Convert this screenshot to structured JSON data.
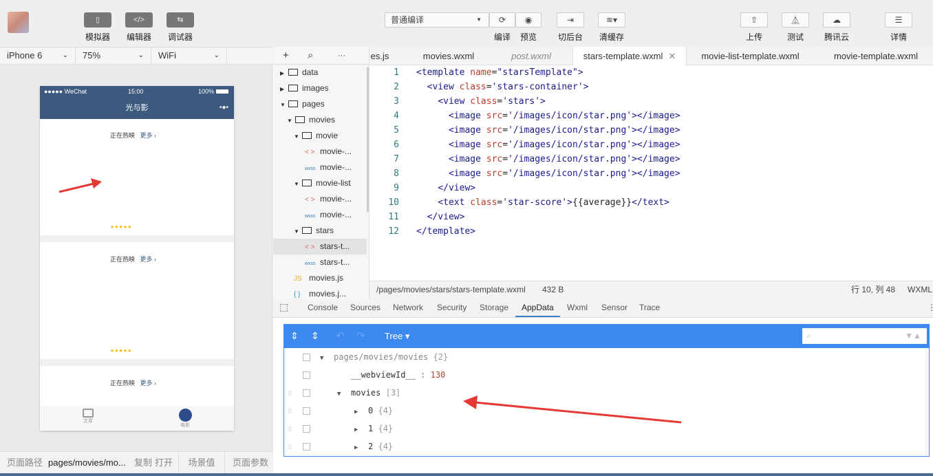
{
  "toolbar": {
    "left": [
      {
        "icon": "phone-icon",
        "label": "模拟器"
      },
      {
        "icon": "code-icon",
        "label": "编辑器"
      },
      {
        "icon": "debug-icon",
        "label": "调试器"
      }
    ],
    "compile_mode": "普通编译",
    "compile": "编译",
    "preview": "预览",
    "background": "切后台",
    "clear_cache": "清缓存",
    "upload": "上传",
    "test": "测试",
    "cloud": "腾讯云",
    "details": "详情"
  },
  "device": {
    "model": "iPhone 6",
    "zoom": "75%",
    "network": "WiFi"
  },
  "phone": {
    "carrier": "●●●●● WeChat",
    "time": "15:00",
    "battery": "100%",
    "title": "光与影",
    "sections": [
      {
        "title": "正在热映",
        "more": "更多 ›",
        "stars": "★★★★★"
      },
      {
        "title": "正在热映",
        "more": "更多 ›",
        "stars": "★★★★★"
      },
      {
        "title": "正在热映",
        "more": "更多 ›"
      }
    ],
    "tabbar": [
      {
        "label": "文章"
      },
      {
        "label": "电影"
      }
    ]
  },
  "bottom": {
    "path_label": "页面路径",
    "path": "pages/movies/mo...",
    "copy": "复制",
    "open": "打开",
    "scene": "场景值",
    "params": "页面参数"
  },
  "filetree": {
    "items": [
      {
        "name": "data",
        "type": "folder",
        "open": false,
        "depth": 0
      },
      {
        "name": "images",
        "type": "folder",
        "open": false,
        "depth": 0
      },
      {
        "name": "pages",
        "type": "folder",
        "open": true,
        "depth": 0
      },
      {
        "name": "movies",
        "type": "folder",
        "open": true,
        "depth": 1
      },
      {
        "name": "movie",
        "type": "folder",
        "open": true,
        "depth": 2
      },
      {
        "name": "movie-...",
        "type": "wxml",
        "badge": "< >",
        "depth": 3
      },
      {
        "name": "movie-...",
        "type": "wxss",
        "badge": "wxss",
        "depth": 3
      },
      {
        "name": "movie-list",
        "type": "folder",
        "open": true,
        "depth": 2
      },
      {
        "name": "movie-...",
        "type": "wxml",
        "badge": "< >",
        "depth": 3
      },
      {
        "name": "movie-...",
        "type": "wxss",
        "badge": "wxss",
        "depth": 3
      },
      {
        "name": "stars",
        "type": "folder",
        "open": true,
        "depth": 2
      },
      {
        "name": "stars-t...",
        "type": "wxml",
        "badge": "< >",
        "depth": 3,
        "selected": true
      },
      {
        "name": "stars-t...",
        "type": "wxss",
        "badge": "wxss",
        "depth": 3
      },
      {
        "name": "movies.js",
        "type": "js",
        "badge": "JS",
        "depth": 2
      },
      {
        "name": "movies.j...",
        "type": "json",
        "badge": "{ }",
        "depth": 2
      }
    ]
  },
  "tabs": [
    "es.js",
    "movies.wxml",
    "post.wxml",
    "stars-template.wxml",
    "movie-list-template.wxml",
    "movie-template.wxml"
  ],
  "active_tab": "stars-template.wxml",
  "code": [
    [
      [
        "tag",
        "<template "
      ],
      [
        "attr",
        "name"
      ],
      [
        "txt",
        "="
      ],
      [
        "str",
        "\"starsTemplate\""
      ],
      [
        "tag",
        ">"
      ]
    ],
    [
      [
        "txt",
        "  "
      ],
      [
        "tag",
        "<view "
      ],
      [
        "attr",
        "class"
      ],
      [
        "txt",
        "="
      ],
      [
        "str",
        "'stars-container'"
      ],
      [
        "tag",
        ">"
      ]
    ],
    [
      [
        "txt",
        "    "
      ],
      [
        "tag",
        "<view "
      ],
      [
        "attr",
        "class"
      ],
      [
        "txt",
        "="
      ],
      [
        "str",
        "'stars'"
      ],
      [
        "tag",
        ">"
      ]
    ],
    [
      [
        "txt",
        "      "
      ],
      [
        "tag",
        "<image "
      ],
      [
        "attr",
        "src"
      ],
      [
        "txt",
        "="
      ],
      [
        "str",
        "'/images/icon/star.png'"
      ],
      [
        "tag",
        "></image>"
      ]
    ],
    [
      [
        "txt",
        "      "
      ],
      [
        "tag",
        "<image "
      ],
      [
        "attr",
        "src"
      ],
      [
        "txt",
        "="
      ],
      [
        "str",
        "'/images/icon/star.png'"
      ],
      [
        "tag",
        "></image>"
      ]
    ],
    [
      [
        "txt",
        "      "
      ],
      [
        "tag",
        "<image "
      ],
      [
        "attr",
        "src"
      ],
      [
        "txt",
        "="
      ],
      [
        "str",
        "'/images/icon/star.png'"
      ],
      [
        "tag",
        "></image>"
      ]
    ],
    [
      [
        "txt",
        "      "
      ],
      [
        "tag",
        "<image "
      ],
      [
        "attr",
        "src"
      ],
      [
        "txt",
        "="
      ],
      [
        "str",
        "'/images/icon/star.png'"
      ],
      [
        "tag",
        "></image>"
      ]
    ],
    [
      [
        "txt",
        "      "
      ],
      [
        "tag",
        "<image "
      ],
      [
        "attr",
        "src"
      ],
      [
        "txt",
        "="
      ],
      [
        "str",
        "'/images/icon/star.png'"
      ],
      [
        "tag",
        "></image>"
      ]
    ],
    [
      [
        "txt",
        "    "
      ],
      [
        "tag",
        "</view>"
      ]
    ],
    [
      [
        "txt",
        "    "
      ],
      [
        "tag",
        "<text "
      ],
      [
        "attr",
        "class"
      ],
      [
        "txt",
        "="
      ],
      [
        "str",
        "'star-score'"
      ],
      [
        "tag",
        ">"
      ],
      [
        "txt",
        "{{average}}"
      ],
      [
        "tag",
        "</text>"
      ]
    ],
    [
      [
        "txt",
        "  "
      ],
      [
        "tag",
        "</view>"
      ]
    ],
    [
      [
        "tag",
        "</template>"
      ]
    ]
  ],
  "status": {
    "path": "/pages/movies/stars/stars-template.wxml",
    "size": "432 B",
    "cursor": "行 10, 列 48",
    "lang": "WXML"
  },
  "devtools": {
    "tabs": [
      "Console",
      "Sources",
      "Network",
      "Security",
      "Storage",
      "AppData",
      "Wxml",
      "Sensor",
      "Trace"
    ],
    "active": "AppData"
  },
  "appdata": {
    "mode": "Tree ▾",
    "rows": [
      {
        "key": "pages/movies/movies",
        "val": "{2}",
        "arrow": "▼",
        "depth": 0
      },
      {
        "key": "__webviewId__",
        "sep": " : ",
        "val": "130",
        "depth": 1,
        "num": true
      },
      {
        "key": "movies",
        "val": "[3]",
        "arrow": "▼",
        "depth": 1,
        "drag": true
      },
      {
        "key": "0",
        "val": " {4}",
        "arrow": "▶",
        "depth": 2,
        "drag": true
      },
      {
        "key": "1",
        "val": " {4}",
        "arrow": "▶",
        "depth": 2,
        "drag": true
      },
      {
        "key": "2",
        "val": " {4}",
        "arrow": "▶",
        "depth": 2,
        "drag": true
      }
    ]
  },
  "colors": {
    "accent": "#3c8af0",
    "phone_nav": "#3d5a7e",
    "arrow": "#e53935"
  }
}
